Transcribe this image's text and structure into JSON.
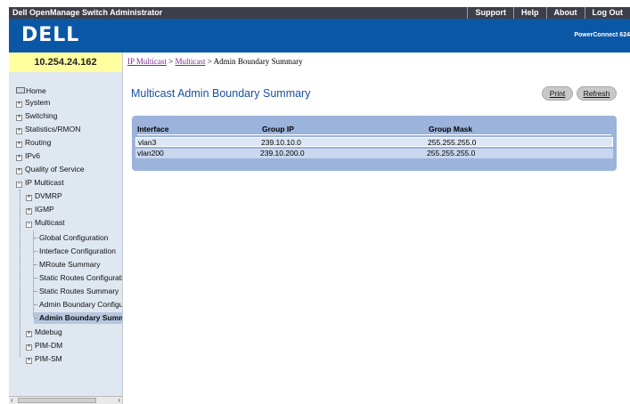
{
  "topbar": {
    "title": "Dell OpenManage Switch Administrator",
    "links": [
      "Support",
      "Help",
      "About",
      "Log Out"
    ]
  },
  "header": {
    "logo": "DELL",
    "product": "PowerConnect 624"
  },
  "ip_address": "10.254.24.162",
  "breadcrumb": {
    "link1": "IP Multicast",
    "sep": " > ",
    "link2": "Multicast",
    "current": " > Admin Boundary Summary"
  },
  "sidebar": {
    "items": [
      {
        "label": "Home"
      },
      {
        "label": "System"
      },
      {
        "label": "Switching"
      },
      {
        "label": "Statistics/RMON"
      },
      {
        "label": "Routing"
      },
      {
        "label": "IPv6"
      },
      {
        "label": "Quality of Service"
      },
      {
        "label": "IP Multicast"
      },
      {
        "label": "DVMRP"
      },
      {
        "label": "IGMP"
      },
      {
        "label": "Multicast"
      },
      {
        "label": "Global Configuration"
      },
      {
        "label": "Interface Configuration"
      },
      {
        "label": "MRoute Summary"
      },
      {
        "label": "Static Routes Configuration"
      },
      {
        "label": "Static Routes Summary"
      },
      {
        "label": "Admin Boundary Configuration"
      },
      {
        "label": "Admin Boundary Summary"
      },
      {
        "label": "Mdebug"
      },
      {
        "label": "PIM-DM"
      },
      {
        "label": "PIM-SM"
      }
    ]
  },
  "main": {
    "title": "Multicast Admin Boundary Summary",
    "print_label": "Print",
    "refresh_label": "Refresh",
    "table": {
      "headers": [
        "Interface",
        "Group IP",
        "Group Mask"
      ],
      "rows": [
        [
          "vlan3",
          "239.10.10.0",
          "255.255.255.0"
        ],
        [
          "vlan200",
          "239.10.200.0",
          "255.255.255.0"
        ]
      ]
    }
  },
  "colors": {
    "header_blue": "#0a57a6",
    "topbar": "#3e3e4a",
    "ip_band": "#ffffa0",
    "title_blue": "#1a4f9c",
    "table_frame": "#9cb3db"
  }
}
